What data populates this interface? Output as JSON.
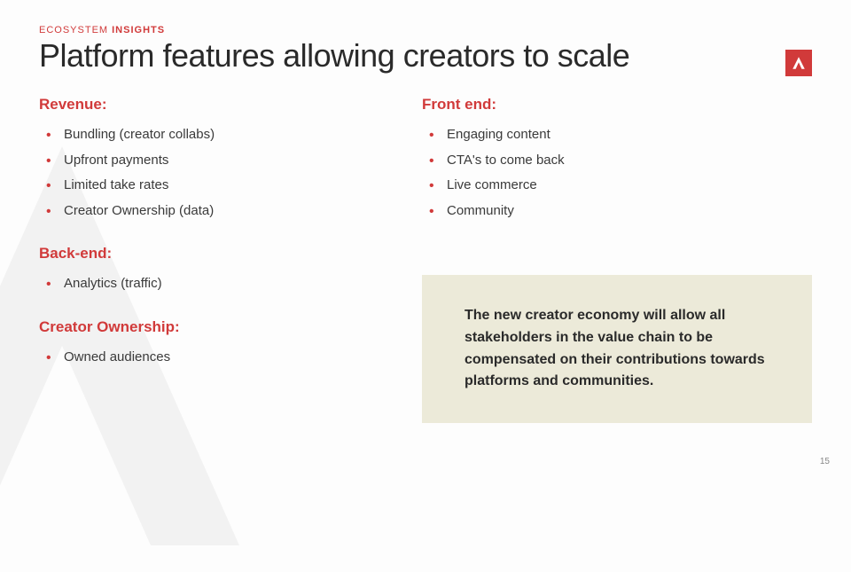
{
  "eyebrow_prefix": "ECOSYSTEM ",
  "eyebrow_bold": "INSIGHTS",
  "title": "Platform features allowing creators to scale",
  "left": {
    "sections": [
      {
        "heading": "Revenue:",
        "items": [
          "Bundling (creator collabs)",
          "Upfront payments",
          "Limited take rates",
          "Creator Ownership (data)"
        ]
      },
      {
        "heading": "Back-end:",
        "items": [
          "Analytics (traffic)"
        ]
      },
      {
        "heading": "Creator Ownership:",
        "items": [
          "Owned audiences"
        ]
      }
    ]
  },
  "right": {
    "sections": [
      {
        "heading": "Front end:",
        "items": [
          "Engaging content",
          "CTA's to come back",
          "Live commerce",
          "Community"
        ]
      }
    ]
  },
  "callout": "The new creator economy will allow all stakeholders in the value chain to be compensated on their contributions towards platforms and communities.",
  "page_number": "15"
}
